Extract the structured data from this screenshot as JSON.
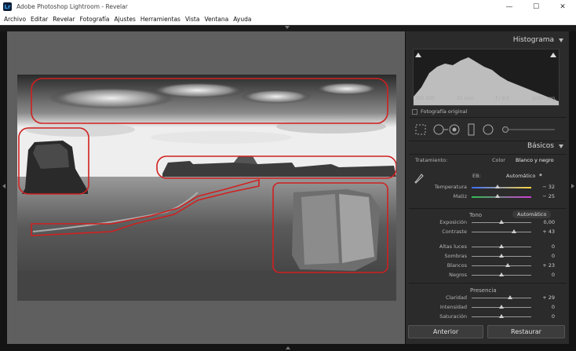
{
  "window": {
    "title": "Adobe Photoshop Lightroom - Revelar",
    "app_icon": "Lr"
  },
  "window_controls": {
    "minimize": "—",
    "maximize": "☐",
    "close": "✕"
  },
  "menu": [
    "Archivo",
    "Editar",
    "Revelar",
    "Fotografía",
    "Ajustes",
    "Herramientas",
    "Vista",
    "Ventana",
    "Ayuda"
  ],
  "histogram": {
    "title": "Histograma",
    "iso": "ISO 200",
    "focal": "21 mm",
    "aperture": "f / 9,0",
    "shutter": "1/320 seg.",
    "original_label": "Fotografía original"
  },
  "basic": {
    "title": "Básicos",
    "treatment_label": "Tratamiento:",
    "treatment_color": "Color",
    "treatment_bw": "Blanco y negro",
    "wb_label": "EB:",
    "wb_value": "Automático",
    "tone_title": "Tono",
    "tone_auto": "Automático",
    "presence_title": "Presencia",
    "sliders": [
      {
        "label": "Temperatura",
        "value": "− 32",
        "pos": 0.44
      },
      {
        "label": "Matiz",
        "value": "− 25",
        "pos": 0.44
      },
      {
        "label": "Exposición",
        "value": "0,00",
        "pos": 0.5
      },
      {
        "label": "Contraste",
        "value": "+ 43",
        "pos": 0.71
      },
      {
        "label": "Altas luces",
        "value": "0",
        "pos": 0.5
      },
      {
        "label": "Sombras",
        "value": "0",
        "pos": 0.5
      },
      {
        "label": "Blancos",
        "value": "+ 23",
        "pos": 0.6
      },
      {
        "label": "Negros",
        "value": "0",
        "pos": 0.5
      },
      {
        "label": "Claridad",
        "value": "+ 29",
        "pos": 0.64
      },
      {
        "label": "Intensidad",
        "value": "0",
        "pos": 0.5
      },
      {
        "label": "Saturación",
        "value": "0",
        "pos": 0.5
      }
    ]
  },
  "buttons": {
    "previous": "Anterior",
    "reset": "Restaurar"
  },
  "colors": {
    "annotation": "#d02020",
    "panel_bg": "#2b2b2b",
    "canvas_bg": "#5f5f5f"
  }
}
